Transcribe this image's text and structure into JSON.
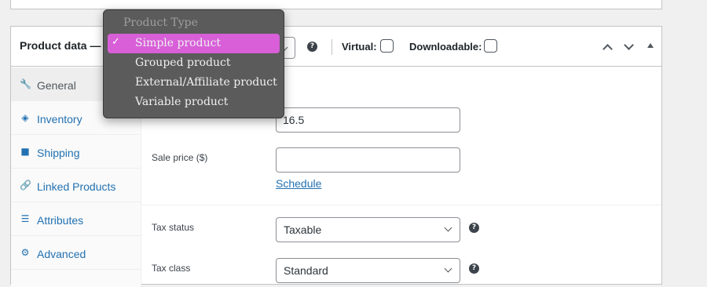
{
  "panel": {
    "title": "Product data —",
    "virtual_label": "Virtual:",
    "downloadable_label": "Downloadable:",
    "help_glyph": "?"
  },
  "tabs": [
    {
      "label": "General",
      "icon": "wrench-icon",
      "glyph": "🔧"
    },
    {
      "label": "Inventory",
      "icon": "tag-icon",
      "glyph": "◈"
    },
    {
      "label": "Shipping",
      "icon": "truck-icon",
      "glyph": "■"
    },
    {
      "label": "Linked Products",
      "icon": "link-icon",
      "glyph": "🔗"
    },
    {
      "label": "Attributes",
      "icon": "list-icon",
      "glyph": "☰"
    },
    {
      "label": "Advanced",
      "icon": "gear-icon",
      "glyph": "⚙"
    }
  ],
  "general": {
    "regular_price_value": "16.5",
    "sale_price_label": "Sale price ($)",
    "sale_price_value": "",
    "schedule_link": "Schedule",
    "tax_status_label": "Tax status",
    "tax_status_value": "Taxable",
    "tax_class_label": "Tax class",
    "tax_class_value": "Standard"
  },
  "product_type_dropdown": {
    "header": "Product Type",
    "check_glyph": "✓",
    "options": [
      {
        "label": "Simple product",
        "selected": true
      },
      {
        "label": "Grouped product",
        "selected": false
      },
      {
        "label": "External/Affiliate product",
        "selected": false
      },
      {
        "label": "Variable product",
        "selected": false
      }
    ]
  },
  "colors": {
    "link": "#2271b1",
    "highlight": "#d85fd8",
    "menu_bg": "#5b5b5b"
  }
}
